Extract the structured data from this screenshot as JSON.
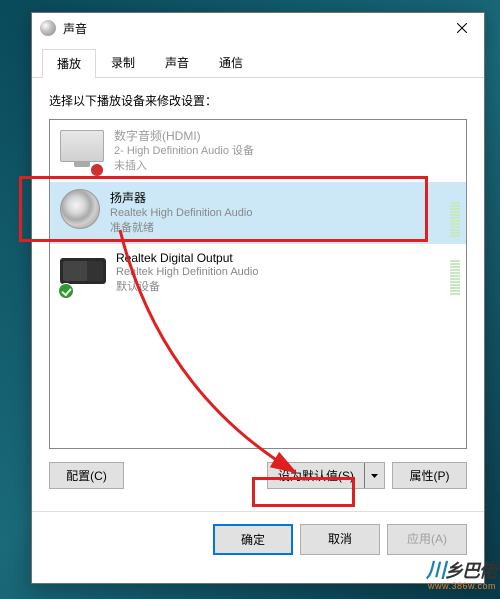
{
  "title": "声音",
  "tabs": [
    "播放",
    "录制",
    "声音",
    "通信"
  ],
  "active_tab": 0,
  "instruction": "选择以下播放设备来修改设置：",
  "devices": [
    {
      "name": "数字音频(HDMI)",
      "driver": "2- High Definition Audio 设备",
      "status": "未插入",
      "selected": false,
      "disabled": true,
      "icon": "monitor",
      "plug_badge": true
    },
    {
      "name": "扬声器",
      "driver": "Realtek High Definition Audio",
      "status": "准备就绪",
      "selected": true,
      "disabled": false,
      "icon": "speaker"
    },
    {
      "name": "Realtek Digital Output",
      "driver": "Realtek High Definition Audio",
      "status": "默认设备",
      "selected": false,
      "disabled": false,
      "icon": "device3",
      "check_badge": true
    }
  ],
  "buttons": {
    "configure": "配置(C)",
    "set_default": "设为默认值(S)",
    "properties": "属性(P)",
    "ok": "确定",
    "cancel": "取消",
    "apply": "应用(A)"
  },
  "watermark": {
    "brand1": "川",
    "brand2": "乡巴佬",
    "url": "www.386w.com"
  }
}
